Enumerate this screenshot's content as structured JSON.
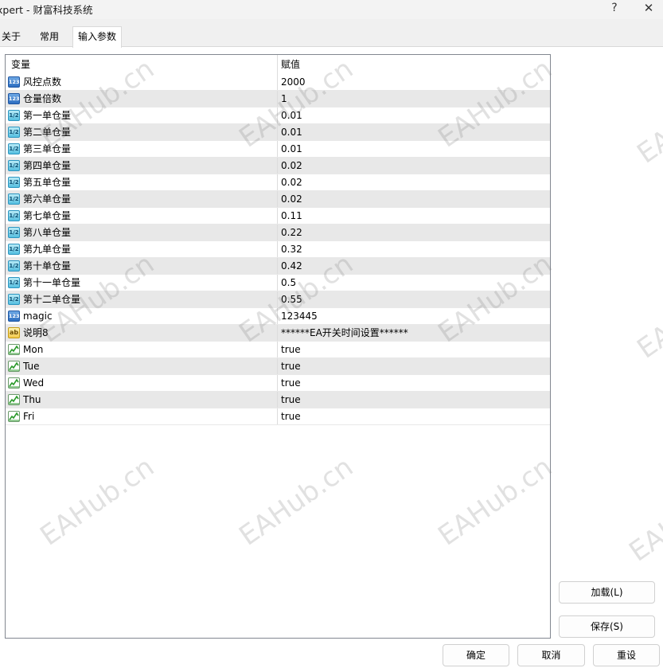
{
  "window": {
    "title": "xpert - 财富科技系统",
    "help_glyph": "?",
    "close_glyph": "✕"
  },
  "tabs": [
    {
      "label": "关于"
    },
    {
      "label": "常用"
    },
    {
      "label": "输入参数",
      "selected": true
    }
  ],
  "grid": {
    "columns": [
      "变量",
      "赋值"
    ],
    "rows": [
      {
        "icon": "integer-icon",
        "icon_text": "123",
        "name": "风控点数",
        "value": "2000"
      },
      {
        "icon": "integer-icon",
        "icon_text": "123",
        "name": "仓量倍数",
        "value": "1"
      },
      {
        "icon": "double-icon",
        "icon_text": "1/2",
        "name": "第一单仓量",
        "value": "0.01"
      },
      {
        "icon": "double-icon",
        "icon_text": "1/2",
        "name": "第二单仓量",
        "value": "0.01"
      },
      {
        "icon": "double-icon",
        "icon_text": "1/2",
        "name": "第三单仓量",
        "value": "0.01"
      },
      {
        "icon": "double-icon",
        "icon_text": "1/2",
        "name": "第四单仓量",
        "value": "0.02"
      },
      {
        "icon": "double-icon",
        "icon_text": "1/2",
        "name": "第五单仓量",
        "value": "0.02"
      },
      {
        "icon": "double-icon",
        "icon_text": "1/2",
        "name": "第六单仓量",
        "value": "0.02"
      },
      {
        "icon": "double-icon",
        "icon_text": "1/2",
        "name": "第七单仓量",
        "value": "0.11"
      },
      {
        "icon": "double-icon",
        "icon_text": "1/2",
        "name": "第八单仓量",
        "value": "0.22"
      },
      {
        "icon": "double-icon",
        "icon_text": "1/2",
        "name": "第九单仓量",
        "value": "0.32"
      },
      {
        "icon": "double-icon",
        "icon_text": "1/2",
        "name": "第十单仓量",
        "value": "0.42"
      },
      {
        "icon": "double-icon",
        "icon_text": "1/2",
        "name": "第十一单仓量",
        "value": "0.5"
      },
      {
        "icon": "double-icon",
        "icon_text": "1/2",
        "name": "第十二单仓量",
        "value": "0.55"
      },
      {
        "icon": "integer-icon",
        "icon_text": "123",
        "name": "magic",
        "value": "123445"
      },
      {
        "icon": "string-icon",
        "icon_text": "ab",
        "name": "说明8",
        "value": "******EA开关时间设置******"
      },
      {
        "icon": "bool-icon",
        "icon_text": "",
        "name": "Mon",
        "value": "true"
      },
      {
        "icon": "bool-icon",
        "icon_text": "",
        "name": "Tue",
        "value": "true"
      },
      {
        "icon": "bool-icon",
        "icon_text": "",
        "name": "Wed",
        "value": "true"
      },
      {
        "icon": "bool-icon",
        "icon_text": "",
        "name": "Thu",
        "value": "true"
      },
      {
        "icon": "bool-icon",
        "icon_text": "",
        "name": "Fri",
        "value": "true"
      }
    ]
  },
  "buttons": {
    "load": "加载(L)",
    "save": "保存(S)",
    "ok": "确定",
    "cancel": "取消",
    "reset": "重设"
  },
  "watermark": "EAHub.cn",
  "colors": {
    "alt_row": "#e8e8e8",
    "grid_border": "#828790",
    "panel_bg": "#ffffff",
    "window_bg": "#f0f0f0"
  }
}
